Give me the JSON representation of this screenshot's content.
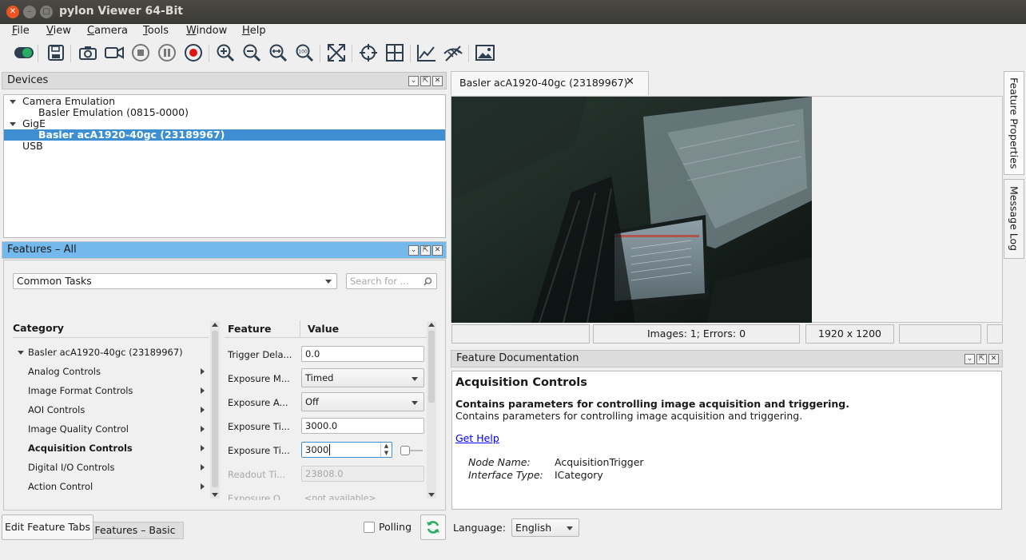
{
  "window": {
    "title": "pylon Viewer 64-Bit"
  },
  "menu": [
    {
      "label": "File",
      "accel": "F",
      "rest": "ile"
    },
    {
      "label": "View",
      "accel": "V",
      "rest": "iew"
    },
    {
      "label": "Camera",
      "accel": "C",
      "rest": "amera"
    },
    {
      "label": "Tools",
      "accel": "T",
      "rest": "ools"
    },
    {
      "label": "Window",
      "accel": "W",
      "rest": "indow"
    },
    {
      "label": "Help",
      "accel": "H",
      "rest": "elp"
    }
  ],
  "toolbar": {
    "icons": [
      "toggle-icon",
      "save-features-icon",
      "single-shot-icon",
      "continuous-shot-icon",
      "stop-icon",
      "pause-icon",
      "record-icon",
      "zoom-in-icon",
      "zoom-out-icon",
      "fit-width-icon",
      "zoom-100-icon",
      "fit-window-icon",
      "crosshair-icon",
      "grid-icon",
      "histogram-icon",
      "hide-overlay-icon",
      "image-icon"
    ],
    "zoom100_label": "100"
  },
  "devices": {
    "title": "Devices",
    "tree": [
      {
        "label": "Camera Emulation",
        "level": 0,
        "expanded": true
      },
      {
        "label": "Basler Emulation (0815-0000)",
        "level": 1
      },
      {
        "label": "GigE",
        "level": 0,
        "expanded": true
      },
      {
        "label": "Basler acA1920-40gc (23189967)",
        "level": 1,
        "selected": true
      },
      {
        "label": "USB",
        "level": 0
      }
    ]
  },
  "features": {
    "title": "Features – All",
    "task_combo": "Common Tasks",
    "search_placeholder": "Search for ...",
    "category_header": "Category",
    "feature_header": "Feature",
    "value_header": "Value",
    "root_category": "Basler acA1920-40gc (23189967)",
    "categories": [
      {
        "label": "Analog Controls",
        "bold": false
      },
      {
        "label": "Image Format Controls",
        "bold": false
      },
      {
        "label": "AOI Controls",
        "bold": false
      },
      {
        "label": "Image Quality Control",
        "bold": false
      },
      {
        "label": "Acquisition Controls",
        "bold": true
      },
      {
        "label": "Digital I/O Controls",
        "bold": false
      },
      {
        "label": "Action Control",
        "bold": false
      }
    ],
    "rows": [
      {
        "name": "Trigger Dela...",
        "value": "0.0",
        "type": "text"
      },
      {
        "name": "Exposure M...",
        "value": "Timed",
        "type": "dropdown"
      },
      {
        "name": "Exposure A...",
        "value": "Off",
        "type": "dropdown"
      },
      {
        "name": "Exposure Ti...",
        "value": "3000.0",
        "type": "text"
      },
      {
        "name": "Exposure Ti...",
        "value": "3000",
        "type": "spin"
      },
      {
        "name": "Readout Ti...",
        "value": "23808.0",
        "type": "disabled"
      },
      {
        "name": "Exposure O...",
        "value": "<not available>",
        "type": "na"
      }
    ]
  },
  "bottom": {
    "edit_tabs_button": "Edit Feature Tabs",
    "basic_tab": "Features – Basic",
    "polling_label": "Polling"
  },
  "image_tab": {
    "title": "Basler acA1920-40gc (23189967)"
  },
  "status": {
    "images": "Images: 1; Errors: 0",
    "resolution": "1920 x 1200"
  },
  "doc": {
    "title": "Feature Documentation",
    "heading": "Acquisition Controls",
    "bold_desc": "Contains parameters for controlling image acquisition and triggering.",
    "desc": "Contains parameters for controlling image acquisition and triggering.",
    "help_link": "Get Help",
    "node_name_label": "Node Name:",
    "node_name": "AcquisitionTrigger",
    "interface_type_label": "Interface Type:",
    "interface_type": "ICategory"
  },
  "language": {
    "label": "Language:",
    "value": "English"
  },
  "side_tabs": [
    "Feature Properties",
    "Message Log"
  ],
  "colors": {
    "selection": "#3d8fd1",
    "active_header": "#74b9ec",
    "record": "#e01414",
    "link": "#0000ee"
  }
}
